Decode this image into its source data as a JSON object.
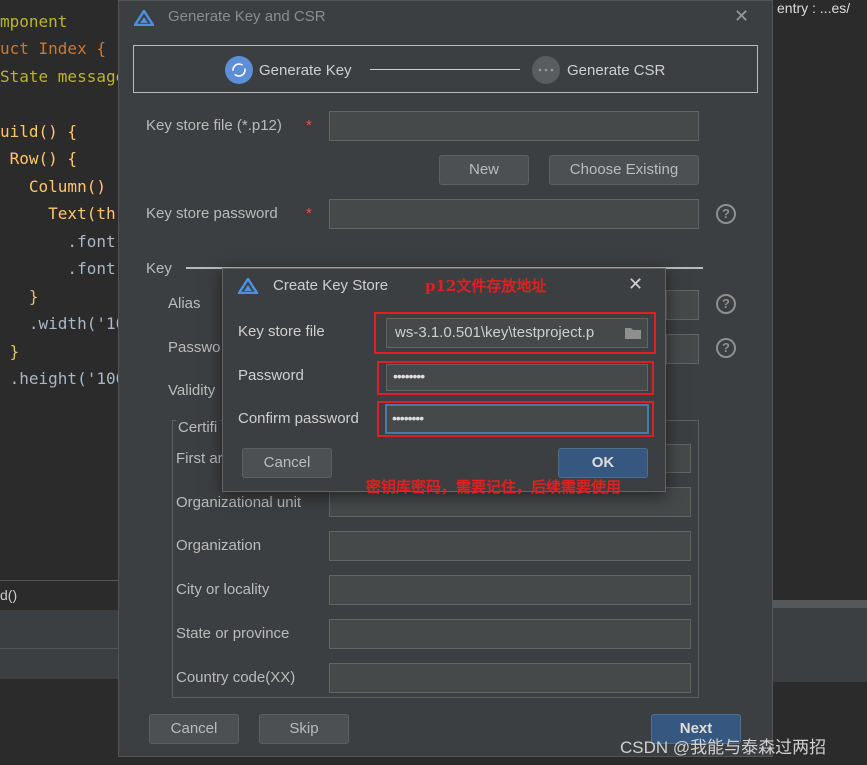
{
  "editor": {
    "lines": [
      {
        "text": "mponent"
      },
      {
        "text": "uct Index {"
      },
      {
        "text": "State message"
      },
      {
        "text": ""
      },
      {
        "text": "uild() {"
      },
      {
        "text": " Row() {"
      },
      {
        "text": "   Column() "
      },
      {
        "text": "     Text(th"
      },
      {
        "text": "       .font"
      },
      {
        "text": "       .font"
      },
      {
        "text": "   }"
      },
      {
        "text": "   .width('10"
      },
      {
        "text": " }"
      },
      {
        "text": " .height('100"
      }
    ],
    "bottom_text": "d()"
  },
  "right_panel": {
    "top_text": "entry : ...es/"
  },
  "dialog": {
    "title": "Generate Key and CSR",
    "close": "✕",
    "steps": {
      "step1": "Generate Key",
      "step2": "Generate CSR"
    },
    "key_store_file_label": "Key store file (*.p12)",
    "key_store_password_label": "Key store password",
    "required_mark": "*",
    "new_button": "New",
    "choose_existing_button": "Choose Existing",
    "key_section_label": "Key",
    "alias_label": "Alias",
    "password_label_partial": "Passwo",
    "validity_label_partial": "Validity",
    "cert_legend_partial": "Certifi",
    "first_name_partial": "First ar",
    "cert_fields": {
      "organizational_unit": "Organizational unit",
      "organization": "Organization",
      "city": "City or locality",
      "state": "State or province",
      "country": "Country code(XX)"
    },
    "help_glyph": "?",
    "cancel_button": "Cancel",
    "skip_button": "Skip",
    "next_button": "Next"
  },
  "sub_dialog": {
    "title": "Create Key Store",
    "close": "✕",
    "key_store_file_label": "Key store file",
    "key_store_file_value": "ws-3.1.0.501\\key\\testproject.p",
    "password_label": "Password",
    "password_value": "••••••••",
    "confirm_password_label": "Confirm password",
    "confirm_password_value": "••••••••",
    "cancel_button": "Cancel",
    "ok_button": "OK"
  },
  "annotations": {
    "p12_note": "p12文件存放地址",
    "password_note": "密钥库密码，需要记住，后续需要使用"
  },
  "watermark": "CSDN @我能与泰森过两招",
  "colors": {
    "accent": "#365880",
    "annotation_red": "#e02020",
    "dialog_bg": "#3c3f41"
  }
}
